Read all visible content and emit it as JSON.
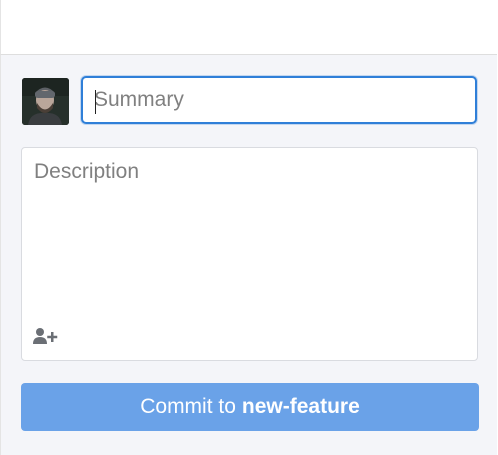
{
  "summary": {
    "placeholder": "Summary",
    "value": ""
  },
  "description": {
    "placeholder": "Description",
    "value": ""
  },
  "commit_button": {
    "prefix": "Commit to",
    "branch": "new-feature"
  },
  "icons": {
    "avatar": "user-avatar",
    "coauthor": "add-coauthor-icon"
  },
  "colors": {
    "accent": "#2f7fd8",
    "commit_button_bg": "#6aa2e8",
    "panel_bg": "#f4f5f9"
  }
}
